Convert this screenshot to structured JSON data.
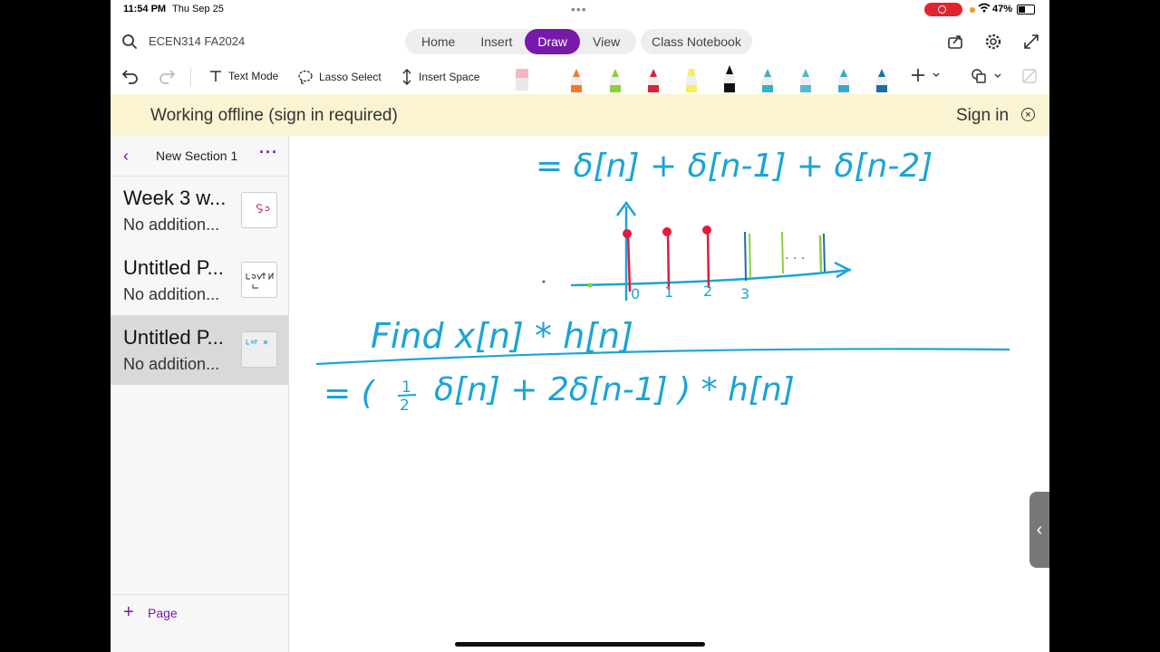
{
  "status": {
    "time": "11:54 PM",
    "date": "Thu Sep 25",
    "battery": "47%"
  },
  "header": {
    "notebook": "ECEN314 FA2024",
    "tabs": [
      "Home",
      "Insert",
      "Draw",
      "View"
    ],
    "active_tab": "Draw",
    "class_notebook": "Class Notebook"
  },
  "toolbar": {
    "text_mode": "Text Mode",
    "lasso_select": "Lasso Select",
    "insert_space": "Insert Space"
  },
  "banner": {
    "message": "Working offline (sign in required)",
    "sign_in": "Sign in"
  },
  "sidebar": {
    "section": "New Section 1",
    "pages": [
      {
        "title": "Week 3 w...",
        "subtitle": "No addition..."
      },
      {
        "title": "Untitled P...",
        "subtitle": "No addition..."
      },
      {
        "title": "Untitled P...",
        "subtitle": "No addition..."
      }
    ],
    "selected_index": 2,
    "add_page": "Page"
  },
  "colors": {
    "accent": "#7719aa",
    "ink_blue": "#1aa4d6",
    "ink_red": "#e5193a",
    "ink_green": "#8ccf3a",
    "banner": "#fbf4d3"
  },
  "pens": [
    "#f6b5c0",
    "#f07a2a",
    "#8ccf3a",
    "#d6243a",
    "#f4f15a",
    "#111111",
    "#35b0c8",
    "#55b8d4",
    "#38a7cf",
    "#1b6fa4"
  ],
  "pen_icons": [
    "eraser-icon",
    "pen-orange-icon",
    "pen-green-icon",
    "pen-red-icon",
    "highlighter-yellow-icon",
    "pen-black-icon",
    "pen-teal-icon",
    "pen-lightblue-icon",
    "pen-cyan-icon",
    "pen-blue-icon"
  ],
  "ink": {
    "line1": "= δ[n] + δ[n-1] + δ[n-2]",
    "stem_labels": [
      "0",
      "1",
      "2",
      "3"
    ],
    "line2": "Find x[n] * h[n]",
    "line3_prefix": "= (",
    "frac_num": "1",
    "frac_den": "2",
    "line3_rest": "δ[n] + 2δ[n-1] ) * h[n]",
    "ellipsis": ". . ."
  }
}
